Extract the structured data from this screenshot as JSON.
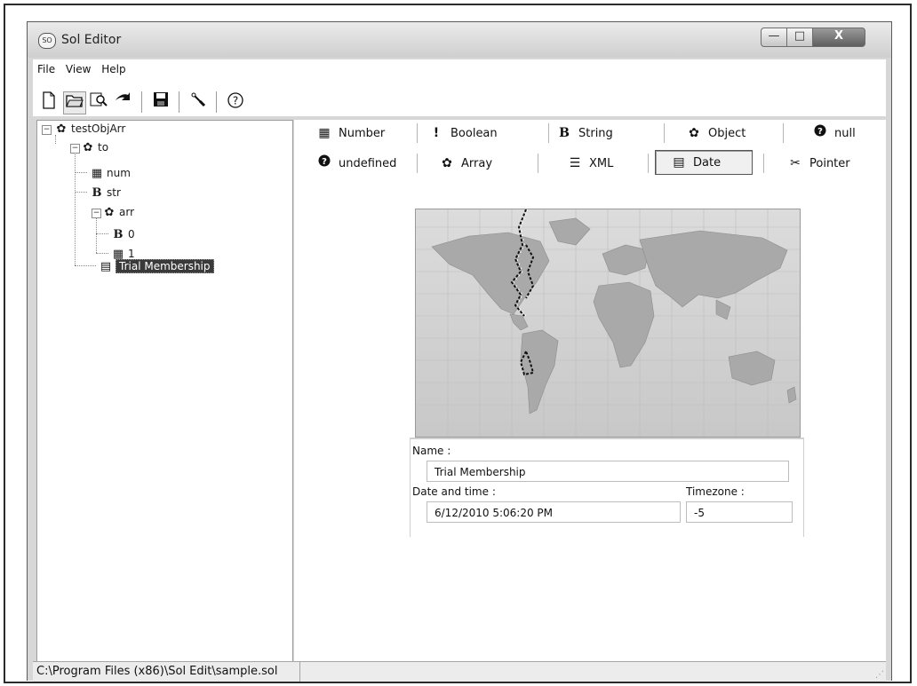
{
  "window": {
    "title": "Sol Editor",
    "icon_text": "SO",
    "minimize": "—",
    "maximize": "□",
    "close": "X"
  },
  "menu": [
    "File",
    "View",
    "Help"
  ],
  "toolbar": {
    "icons": [
      "new-file-icon",
      "open-folder-icon",
      "find-icon",
      "export-icon",
      "save-icon",
      "settings-icon",
      "help-icon"
    ],
    "glyphs": {
      "new": "🗋",
      "open": "🗁",
      "find": "🔍",
      "export": "❖",
      "save": "▪",
      "settings": "✎",
      "help": "?"
    }
  },
  "tree": {
    "root": "testObjArr",
    "to": "to",
    "num": "num",
    "str": "str",
    "arr": "arr",
    "arr0": "0",
    "arr1": "1",
    "trial": "Trial Membership"
  },
  "types": {
    "number": "Number",
    "boolean": "Boolean",
    "string": "String",
    "object": "Object",
    "null": "null",
    "undefined": "undefined",
    "array": "Array",
    "xml": "XML",
    "date": "Date",
    "pointer": "Pointer",
    "glyph_b": "B",
    "glyph_bang": "!",
    "glyph_q": "?"
  },
  "form": {
    "name_label": "Name :",
    "name_value": "Trial Membership",
    "datetime_label": "Date and time :",
    "datetime_value": "6/12/2010 5:06:20 PM",
    "timezone_label": "Timezone :",
    "timezone_value": "-5"
  },
  "status": {
    "path": "C:\\Program Files (x86)\\Sol Edit\\sample.sol"
  }
}
